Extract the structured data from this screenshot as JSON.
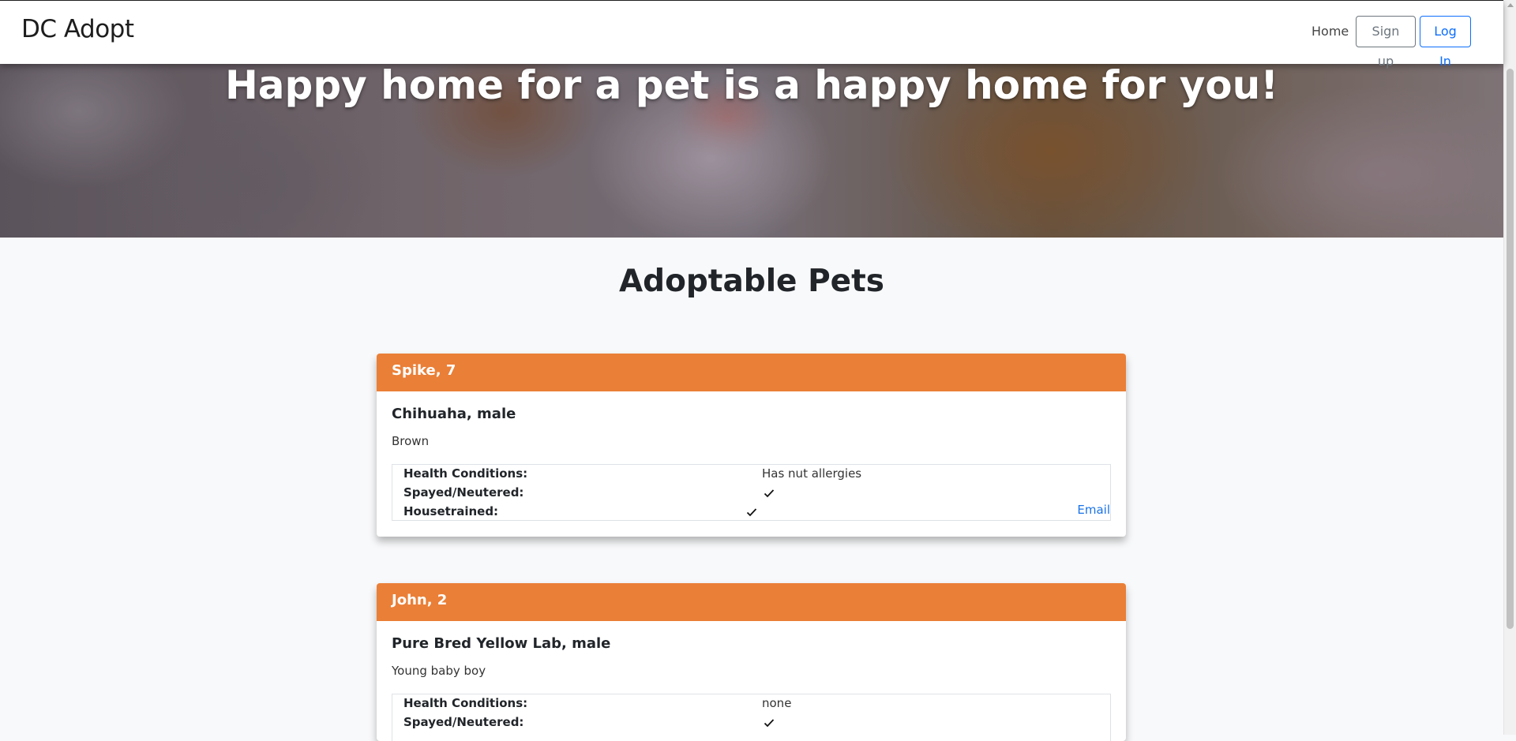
{
  "nav": {
    "brand": "DC Adopt",
    "home": "Home",
    "signup": "Sign up",
    "login": "Log In"
  },
  "hero": {
    "title": "Happy home for a pet is a happy home for you!"
  },
  "main": {
    "heading": "Adoptable Pets"
  },
  "labels": {
    "health": "Health Conditions:",
    "spayed": "Spayed/Neutered:",
    "housetrained": "Housetrained:",
    "email": "Email"
  },
  "pets": [
    {
      "title": "Spike, 7",
      "subtitle": "Chihuaha, male",
      "description": "Brown",
      "health": "Has nut allergies",
      "spayed": true,
      "housetrained": true
    },
    {
      "title": "John, 2",
      "subtitle": "Pure Bred Yellow Lab, male",
      "description": "Young baby boy",
      "health": "none",
      "spayed": true
    }
  ],
  "colors": {
    "card_header": "#ea7f37",
    "link": "#1a73e8",
    "login_border": "#0d6efd",
    "signup_border": "#6c757d",
    "page_bg": "#f8f9fa"
  },
  "icons": {
    "check": "checkmark-icon"
  }
}
